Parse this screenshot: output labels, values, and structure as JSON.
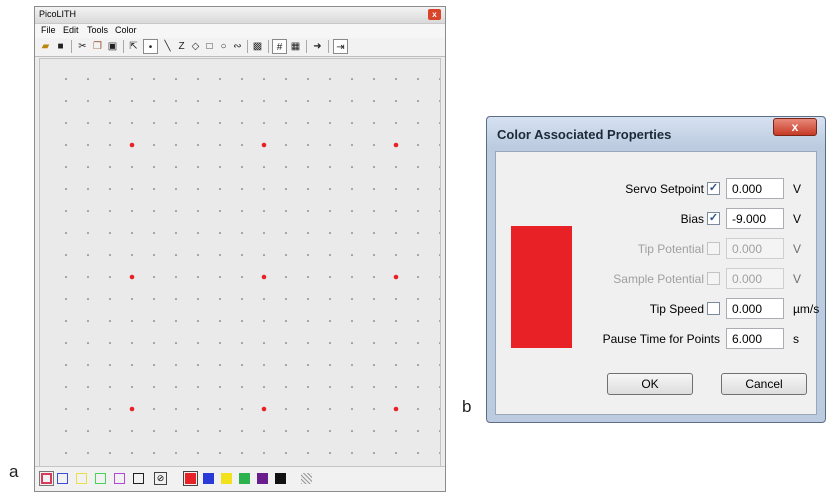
{
  "figure_labels": {
    "a": "a",
    "b": "b"
  },
  "window_a": {
    "title": "PicoLITH",
    "close_glyph": "x",
    "menu": [
      "File",
      "Edit",
      "Tools",
      "Color"
    ],
    "toolbar_icons": [
      "open-folder-icon",
      "save-icon",
      "cut-icon",
      "copy-icon",
      "paste-icon",
      "select-arrow-icon",
      "point-tool-icon",
      "line-tool-icon",
      "polyline-tool-icon",
      "diamond-tool-icon",
      "rectangle-tool-icon",
      "circle-tool-icon",
      "freehand-tool-icon",
      "fill-icon",
      "grid-small-icon",
      "grid-large-icon",
      "arrow-right-icon",
      "export-icon"
    ],
    "palette": {
      "outline_colors": [
        "#d63b5a",
        "#3b4fd6",
        "#e8e04a",
        "#4ad25a",
        "#b04ad6",
        "#202020"
      ],
      "fill_colors": [
        "#e82127",
        "#2a3ad6",
        "#f2e21e",
        "#2bb24c",
        "#6a1d8c",
        "#111111"
      ]
    },
    "grid": {
      "dot_color": "#555555",
      "red_point_color": "#e82127"
    }
  },
  "dialog_b": {
    "title": "Color Associated Properties",
    "close_glyph": "x",
    "color_swatch": "#e82127",
    "rows": [
      {
        "label": "Servo Setpoint",
        "checked": true,
        "enabled": true,
        "value": "0.000",
        "unit": "V"
      },
      {
        "label": "Bias",
        "checked": true,
        "enabled": true,
        "value": "-9.000",
        "unit": "V"
      },
      {
        "label": "Tip Potential",
        "checked": false,
        "enabled": false,
        "value": "0.000",
        "unit": "V"
      },
      {
        "label": "Sample Potential",
        "checked": false,
        "enabled": false,
        "value": "0.000",
        "unit": "V"
      },
      {
        "label": "Tip Speed",
        "checked": false,
        "enabled": true,
        "value": "0.000",
        "unit": "µm/s"
      },
      {
        "label": "Pause Time for Points",
        "checkbox": false,
        "enabled": true,
        "value": "6.000",
        "unit": "s"
      }
    ],
    "ok_label": "OK",
    "cancel_label": "Cancel",
    "check_glyph": "✓"
  }
}
